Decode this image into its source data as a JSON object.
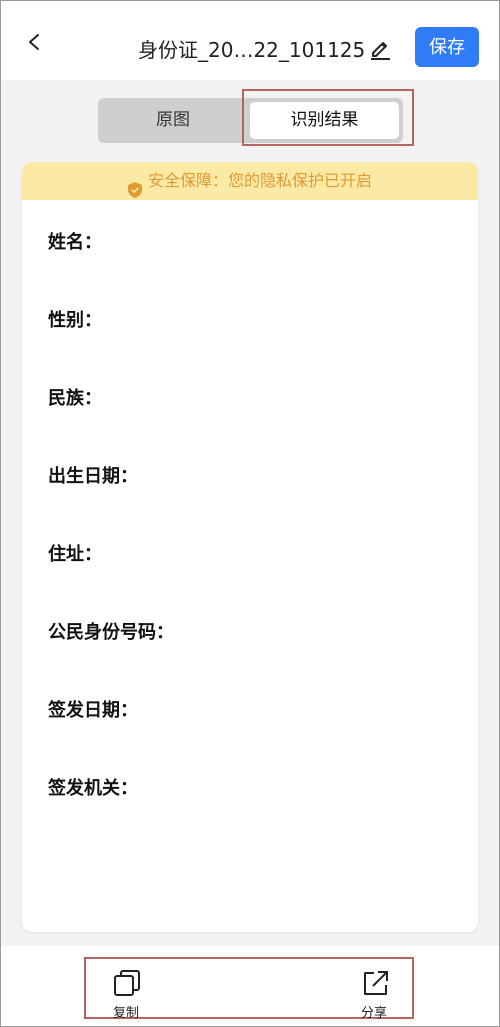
{
  "header": {
    "title": "身份证_20…22_101125",
    "save_label": "保存"
  },
  "tabs": {
    "original": "原图",
    "result": "识别结果"
  },
  "privacy_banner": "安全保障：您的隐私保护已开启",
  "fields": [
    "姓名：",
    "性别：",
    "民族：",
    "出生日期：",
    "住址：",
    "公民身份号码：",
    "签发日期：",
    "签发机关："
  ],
  "toolbar": {
    "copy_label": "复制",
    "share_label": "分享"
  },
  "colors": {
    "accent": "#2f7cf6",
    "privacy_bg": "#fbeaa6",
    "privacy_text": "#e19b35",
    "highlight": "#b5655e"
  },
  "icons": [
    "back-icon",
    "edit-icon",
    "shield-icon",
    "copy-icon",
    "share-icon"
  ]
}
